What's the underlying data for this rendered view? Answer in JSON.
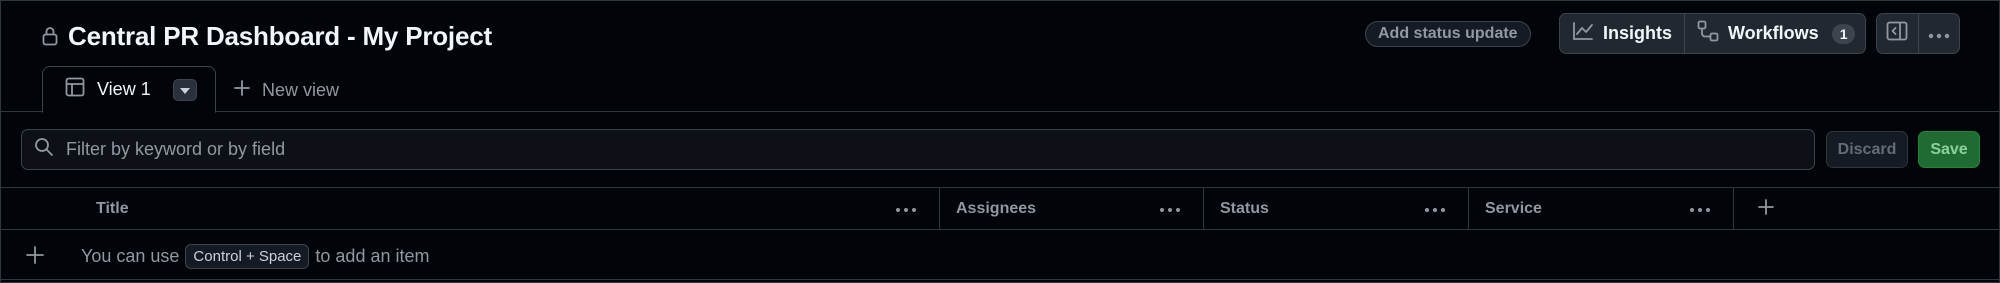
{
  "header": {
    "title": "Central PR Dashboard - My Project",
    "status_update_label": "Add status update",
    "insights_label": "Insights",
    "workflows_label": "Workflows",
    "workflows_count": "1"
  },
  "tabs": {
    "active_label": "View 1",
    "new_view_label": "New view"
  },
  "filter": {
    "placeholder": "Filter by keyword or by field",
    "discard_label": "Discard",
    "save_label": "Save"
  },
  "table": {
    "columns": [
      "Title",
      "Assignees",
      "Status",
      "Service"
    ],
    "hint_before": "You can use",
    "hint_key": "Control + Space",
    "hint_after": "to add an item"
  },
  "colors": {
    "background": "#010409",
    "border": "#30363d",
    "save_bg": "#1f6b33"
  },
  "icons": [
    "lock-icon",
    "graph-icon",
    "workflow-icon",
    "sidebar-panel-icon",
    "kebab-horizontal-icon",
    "table-icon",
    "caret-down-icon",
    "plus-icon",
    "search-icon"
  ]
}
